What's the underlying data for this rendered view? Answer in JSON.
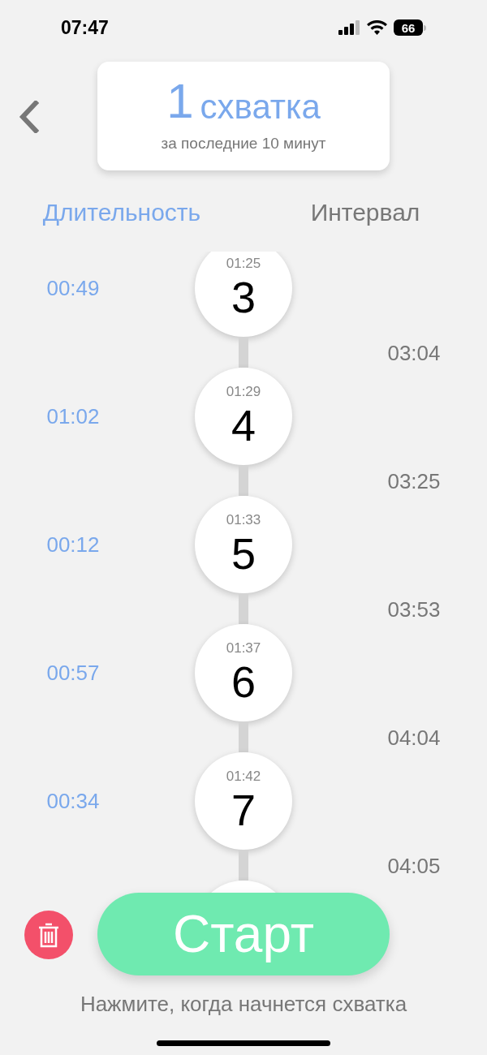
{
  "status_bar": {
    "time": "07:47",
    "battery": "66"
  },
  "summary": {
    "count": "1",
    "unit": "схватка",
    "subtitle": "за последние 10 минут"
  },
  "columns": [
    "Длительность",
    "Интервал"
  ],
  "contractions": [
    {
      "number": "3",
      "time": "01:25",
      "duration": "00:49",
      "interval": "03:04"
    },
    {
      "number": "4",
      "time": "01:29",
      "duration": "01:02",
      "interval": "03:25"
    },
    {
      "number": "5",
      "time": "01:33",
      "duration": "00:12",
      "interval": "03:53"
    },
    {
      "number": "6",
      "time": "01:37",
      "duration": "00:57",
      "interval": "04:04"
    },
    {
      "number": "7",
      "time": "01:42",
      "duration": "00:34",
      "interval": "04:05"
    }
  ],
  "start_button": "Старт",
  "hint": "Нажмите, когда начнется схватка"
}
